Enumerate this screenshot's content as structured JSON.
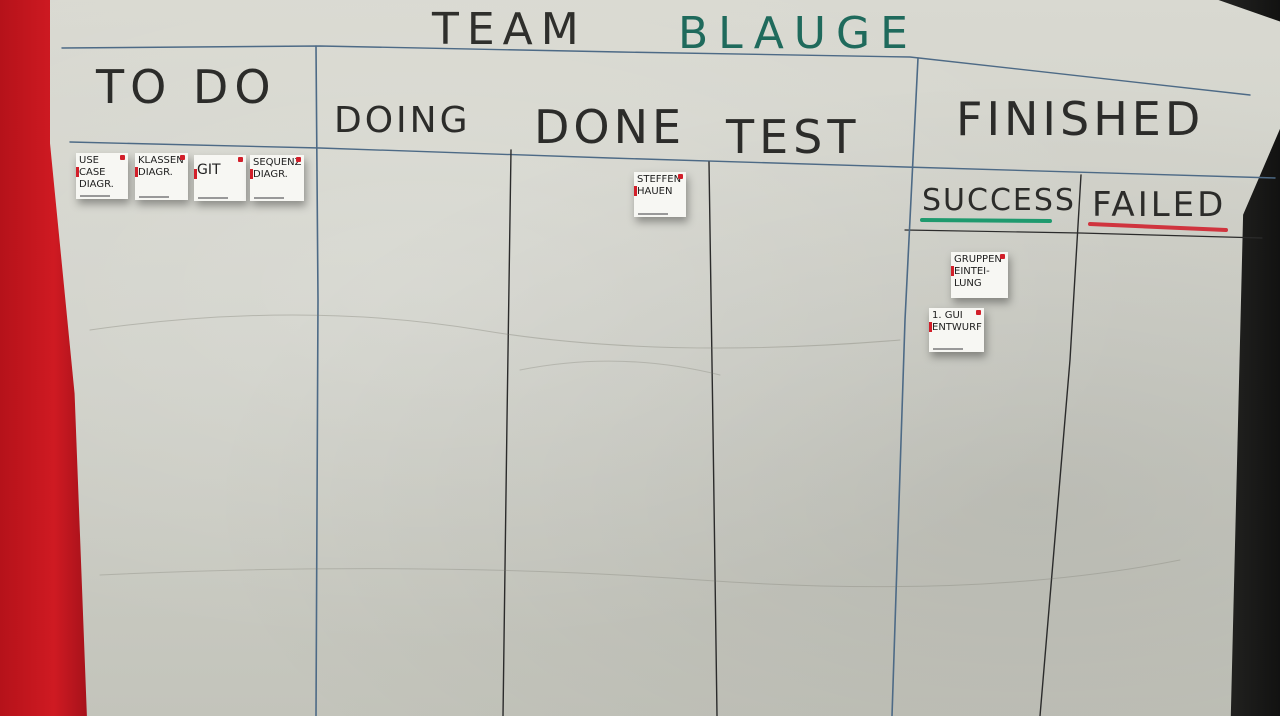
{
  "board": {
    "title_part1": "TEAM",
    "title_part2": "BLAUGE",
    "columns": {
      "todo": "TO DO",
      "doing": "DOING",
      "done": "DONE",
      "test": "TEST",
      "finished": "FINISHED",
      "success": "SUCCESS",
      "failed": "FAILED"
    },
    "notes": {
      "todo": [
        {
          "line1": "USE CASE",
          "line2": "DIAGR."
        },
        {
          "line1": "KLASSEN",
          "line2": "DIAGR."
        },
        {
          "line1": "GIT",
          "line2": ""
        },
        {
          "line1": "SEQUENZ",
          "line2": "DIAGR."
        }
      ],
      "done": [
        {
          "line1": "STEFFEN",
          "line2": "HAUEN"
        }
      ],
      "success": [
        {
          "line1": "GRUPPEN",
          "line2": "EINTEI-",
          "line3": "LUNG"
        },
        {
          "line1": "1. GUI",
          "line2": "ENTWURF"
        }
      ]
    },
    "colors": {
      "paper": "#d2d3cb",
      "title_blue": "#1f6a5c",
      "success_underline": "#1f9a6e",
      "failed_underline": "#d0343e",
      "sticky_mark": "#d21f2a",
      "wall_red": "#cf1a22"
    }
  }
}
